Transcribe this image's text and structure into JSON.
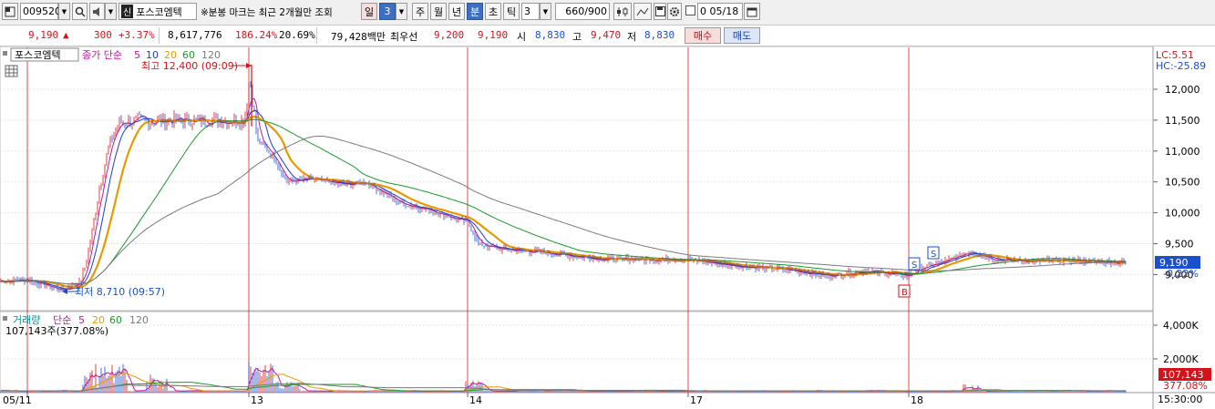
{
  "toolbar": {
    "stock_code": "009520",
    "stock_badge": "신",
    "stock_name": "포스코엠텍",
    "notice": "※분봉 마크는 최근 2개월만 조회",
    "period_day": "일",
    "period_value": "3",
    "period_week": "주",
    "period_month": "월",
    "period_year": "년",
    "period_minute": "분",
    "period_second": "초",
    "period_tick": "틱",
    "interval_value": "3",
    "count_display": "660/900",
    "date_value": "0 05/18"
  },
  "price_bar": {
    "price": "9,190",
    "change": "300",
    "change_pct": "+3.37%",
    "volume": "8,617,776",
    "volume_ratio": "186.24%",
    "turnover": "20.69%",
    "amount": "79,428백만",
    "best_label": "최우선",
    "ask": "9,200",
    "bid": "9,190",
    "open_label": "시",
    "open": "8,830",
    "high_label": "고",
    "high": "9,470",
    "low_label": "저",
    "low": "8,830",
    "buy_label": "매수",
    "sell_label": "매도"
  },
  "price_panel": {
    "title": "포스코엠텍",
    "indicator_label": "종가 단순",
    "ma_periods": [
      "5",
      "10",
      "20",
      "60",
      "120"
    ],
    "ma_colors": [
      "#c0189a",
      "#1a3ec8",
      "#e89a00",
      "#1a9a2a",
      "#7a7a7a"
    ],
    "high_marker": "최고 12,400 (09:09)",
    "low_marker": "최저 8,710 (09:57)",
    "lc_label": "LC:5.51",
    "hc_label": "HC:-25.89",
    "current_price": "9,190",
    "current_pct": "-0.22%",
    "signal_s": "S",
    "signal_b": "B"
  },
  "volume_panel": {
    "title": "거래량",
    "indicator_label": "단순",
    "ma_periods": [
      "5",
      "20",
      "60",
      "120"
    ],
    "ma_colors": [
      "#c0189a",
      "#e89a00",
      "#1a9a2a",
      "#7a7a7a"
    ],
    "current_volume": "107,143주(377.08%)",
    "current_value": "107,143",
    "current_pct": "377.08%"
  },
  "axis": {
    "price_ticks": [
      "12,000",
      "11,500",
      "11,000",
      "10,500",
      "10,000",
      "9,500",
      "9,000"
    ],
    "volume_ticks": [
      "4,000K",
      "2,000K"
    ],
    "date_labels": [
      "05/11",
      "13",
      "14",
      "17",
      "18"
    ],
    "time_label": "15:30:00"
  },
  "colors": {
    "up": "#d4141a",
    "down": "#1a4fd0",
    "selected": "#3d6fc4",
    "divider": "#d42020"
  },
  "chart_data": {
    "type": "line",
    "title": "포스코엠텍",
    "x": [
      "05/11",
      "13",
      "14",
      "17",
      "18"
    ],
    "series": [
      {
        "name": "종가",
        "values": [
          8890,
          11500,
          9900,
          9250,
          9190
        ]
      }
    ],
    "ylim": [
      8600,
      12500
    ],
    "high": 12400,
    "low": 8710
  }
}
